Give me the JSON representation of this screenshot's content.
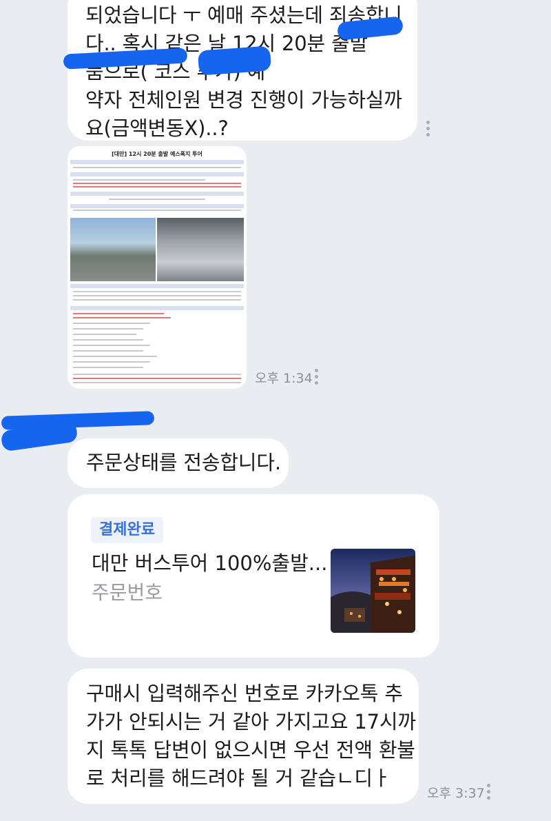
{
  "messages": [
    {
      "id": "msg1",
      "text": "되었습니다 ㅜ 예매 주셨는데 죄송합니\n다.. 혹시 같은 날 12시 20분 출발\n품으로(          코스 추가) 예\n약자 전체인원 변경 진행이 가능하실까\n요(금액변동X)..?"
    },
    {
      "id": "msg2",
      "image": {
        "title": "[대만] 12시 20분 출발 예스폭지 투어"
      },
      "time": "오후 1:34"
    },
    {
      "id": "msg3",
      "text": "주문상태를 전송합니다."
    },
    {
      "id": "msg4",
      "order_card": {
        "badge": "결제완료",
        "product": "대만 버스투어 100%출발...",
        "order_label": "주문번호"
      }
    },
    {
      "id": "msg5",
      "text": "구매시 입력해주신 번호로 카카오톡 추\n가가 안되시는 거 같아 가지고요 17시까\n지 톡톡 답변이 없으시면 우선 전액 환불\n로 처리를 해드려야 될 거 같습ㄴ디ㅏ",
      "time": "오후 3:37"
    }
  ],
  "colors": {
    "background": "#e9edf2",
    "bubble": "#ffffff",
    "badge_text": "#3a6fd8",
    "scribble": "#1565ee"
  }
}
